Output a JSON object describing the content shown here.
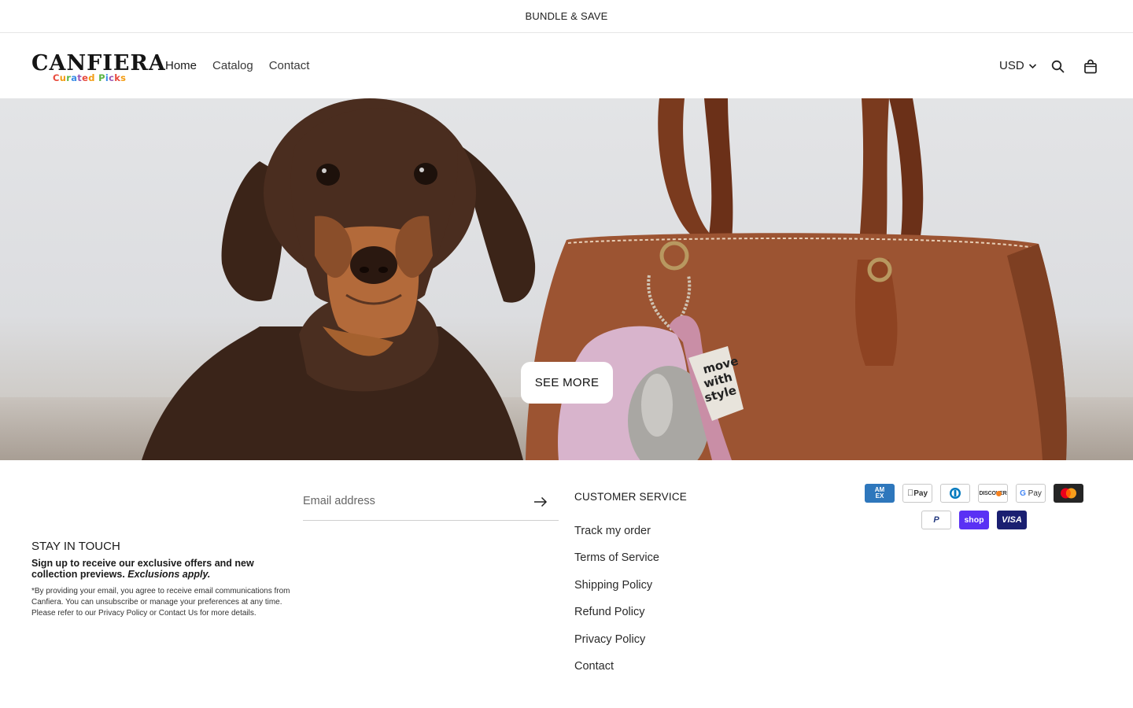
{
  "announcement": "BUNDLE & SAVE",
  "logo": {
    "brand": "CANFIERA",
    "tagline": "Curated Picks"
  },
  "nav": [
    {
      "label": "Home"
    },
    {
      "label": "Catalog"
    },
    {
      "label": "Contact"
    }
  ],
  "header": {
    "currency": "USD"
  },
  "hero": {
    "cta_label": "SEE MORE",
    "tag_text": [
      "move",
      "with",
      "style"
    ]
  },
  "newsletter": {
    "title": "STAY IN TOUCH",
    "subtitle": "Sign up to receive our exclusive offers and new collection previews.",
    "subtitle_em": "Exclusions apply.",
    "legal": "*By providing your email, you agree to receive email communications from Canfiera. You can unsubscribe or manage your preferences at any time. Please refer to our Privacy Policy or Contact Us for more details.",
    "placeholder": "Email address"
  },
  "customer_service": {
    "title": "CUSTOMER SERVICE",
    "links": [
      "Track my order",
      "Terms of Service",
      "Shipping Policy",
      "Refund Policy",
      "Privacy Policy",
      "Contact"
    ]
  },
  "payments": {
    "amex": "AM EX",
    "applepay": "Pay",
    "discover": "DISCOVER",
    "gpay": "Pay",
    "paypal": "P",
    "shoppay": "shop",
    "visa": "VISA"
  },
  "colors": {
    "shop_pay": "#5a31f4",
    "visa": "#1a1f71",
    "amex": "#2e77bc",
    "mastercard_bg": "#252525"
  }
}
